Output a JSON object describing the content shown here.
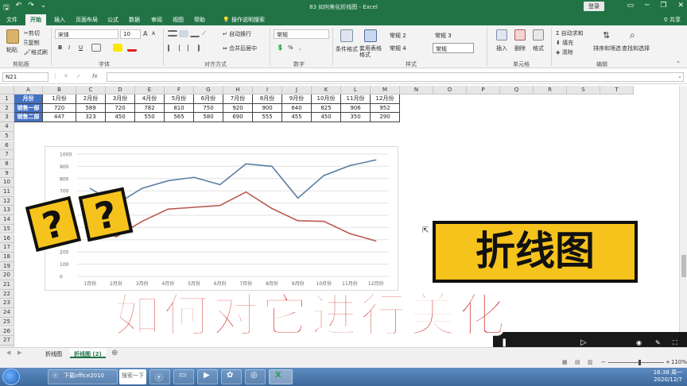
{
  "window": {
    "title": "83 如何美化折线图 - Excel",
    "login": "登录"
  },
  "qat": {
    "save": "🖫",
    "undo": "↶",
    "redo": "↷",
    "customize": "⌄"
  },
  "tabs": [
    "文件",
    "开始",
    "插入",
    "页面布局",
    "公式",
    "数据",
    "审阅",
    "视图",
    "帮助",
    "操作说明搜索"
  ],
  "share": "共享",
  "ribbon": {
    "clipboard": {
      "paste": "粘贴",
      "cut": "剪切",
      "copy": "复制",
      "format_painter": "格式刷",
      "label": "剪贴板"
    },
    "font": {
      "name": "宋体",
      "size": "10",
      "label": "字体",
      "bold": "B",
      "italic": "I",
      "underline": "U",
      "grow": "A",
      "shrink": "A"
    },
    "alignment": {
      "wrap": "自动换行",
      "merge": "合并后居中",
      "label": "对齐方式"
    },
    "number": {
      "format": "常规",
      "percent": "%",
      "comma": ",",
      "label": "数字"
    },
    "styles": {
      "conditional": "条件格式",
      "table": "套用表格格式",
      "s1": "常规 2",
      "s2": "常规 3",
      "s3": "常规 4",
      "s4": "常规",
      "label": "样式"
    },
    "cells": {
      "insert": "插入",
      "delete": "删除",
      "format": "格式",
      "label": "单元格"
    },
    "editing": {
      "autosum": "自动求和",
      "fill": "填充",
      "clear": "清除",
      "sort": "排序和筛选",
      "find": "查找和选择",
      "label": "编辑"
    }
  },
  "namebox": "N21",
  "fx": "fx",
  "columns": [
    "A",
    "B",
    "C",
    "D",
    "E",
    "F",
    "G",
    "H",
    "I",
    "J",
    "K",
    "L",
    "M",
    "N",
    "O",
    "P",
    "Q",
    "R",
    "S",
    "T"
  ],
  "rows": [
    "1",
    "2",
    "3",
    "4",
    "5",
    "6",
    "7",
    "8",
    "9",
    "10",
    "11",
    "12",
    "13",
    "14",
    "15",
    "16",
    "17",
    "18",
    "19",
    "20",
    "21",
    "22",
    "23",
    "24",
    "25",
    "26",
    "27",
    "28",
    "29"
  ],
  "table": {
    "headers": [
      "月份",
      "1月份",
      "2月份",
      "3月份",
      "4月份",
      "5月份",
      "6月份",
      "7月份",
      "8月份",
      "9月份",
      "10月份",
      "11月份",
      "12月份"
    ],
    "rows": [
      [
        "销售一部",
        "720",
        "589",
        "720",
        "782",
        "810",
        "750",
        "920",
        "900",
        "640",
        "825",
        "906",
        "952"
      ],
      [
        "销售二部",
        "447",
        "323",
        "450",
        "550",
        "565",
        "580",
        "690",
        "555",
        "455",
        "450",
        "350",
        "290"
      ]
    ]
  },
  "chart_data": {
    "type": "line",
    "categories": [
      "1月份",
      "2月份",
      "3月份",
      "4月份",
      "5月份",
      "6月份",
      "7月份",
      "8月份",
      "9月份",
      "10月份",
      "11月份",
      "12月份"
    ],
    "series": [
      {
        "values": [
          720,
          589,
          720,
          782,
          810,
          750,
          920,
          900,
          640,
          825,
          906,
          952
        ],
        "color": "#5b7fa6"
      },
      {
        "values": [
          447,
          323,
          450,
          550,
          565,
          580,
          690,
          555,
          455,
          450,
          350,
          290
        ],
        "color": "#b95b52"
      }
    ],
    "yticks": [
      "0",
      "100",
      "200",
      "300",
      "400",
      "500",
      "600",
      "700",
      "800",
      "900",
      "1000"
    ],
    "ylim": [
      0,
      1000
    ],
    "grid": true
  },
  "overlay": {
    "main_title": "如何对它进行美化",
    "label": "折线图",
    "q1": "?",
    "q2": "?"
  },
  "sheets": [
    "折线图",
    "折线图 (2)"
  ],
  "status": {
    "zoom": "110%"
  },
  "taskbar": {
    "item1": "下载office2010",
    "search": "搜索一下",
    "time": "16:38 周一",
    "date": "2020/12/7"
  }
}
